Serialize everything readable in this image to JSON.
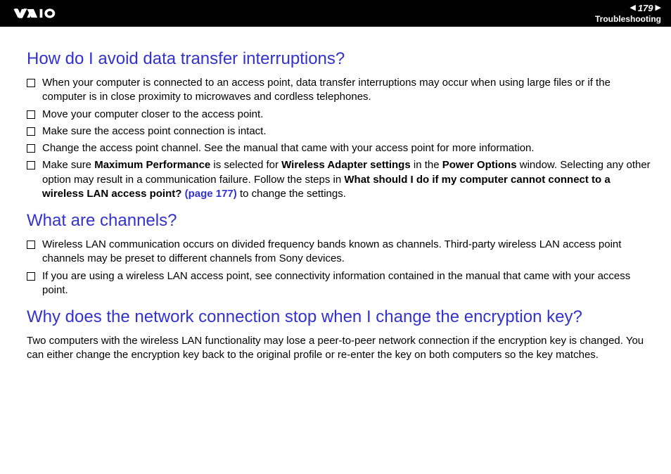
{
  "header": {
    "page_number": "179",
    "section": "Troubleshooting"
  },
  "sections": [
    {
      "heading": "How do I avoid data transfer interruptions?",
      "items": [
        {
          "text": "When your computer is connected to an access point, data transfer interruptions may occur when using large files or if the computer is in close proximity to microwaves and cordless telephones."
        },
        {
          "text": "Move your computer closer to the access point."
        },
        {
          "text": "Make sure the access point connection is intact."
        },
        {
          "text": "Change the access point channel. See the manual that came with your access point for more information."
        },
        {
          "parts": [
            {
              "t": "Make sure "
            },
            {
              "t": "Maximum Performance",
              "bold": true
            },
            {
              "t": " is selected for "
            },
            {
              "t": "Wireless Adapter settings",
              "bold": true
            },
            {
              "t": " in the "
            },
            {
              "t": "Power Options",
              "bold": true
            },
            {
              "t": " window. Selecting any other option may result in a communication failure. Follow the steps in "
            },
            {
              "t": "What should I do if my computer cannot connect to a wireless LAN access point? ",
              "bold": true
            },
            {
              "t": "(page 177)",
              "link": true,
              "bold": true
            },
            {
              "t": " to change the settings."
            }
          ]
        }
      ]
    },
    {
      "heading": "What are channels?",
      "items": [
        {
          "text": "Wireless LAN communication occurs on divided frequency bands known as channels. Third-party wireless LAN access point channels may be preset to different channels from Sony devices."
        },
        {
          "text": "If you are using a wireless LAN access point, see connectivity information contained in the manual that came with your access point."
        }
      ]
    },
    {
      "heading": "Why does the network connection stop when I change the encryption key?",
      "paragraph": "Two computers with the wireless LAN functionality may lose a peer-to-peer network connection if the encryption key is changed. You can either change the encryption key back to the original profile or re-enter the key on both computers so the key matches."
    }
  ]
}
